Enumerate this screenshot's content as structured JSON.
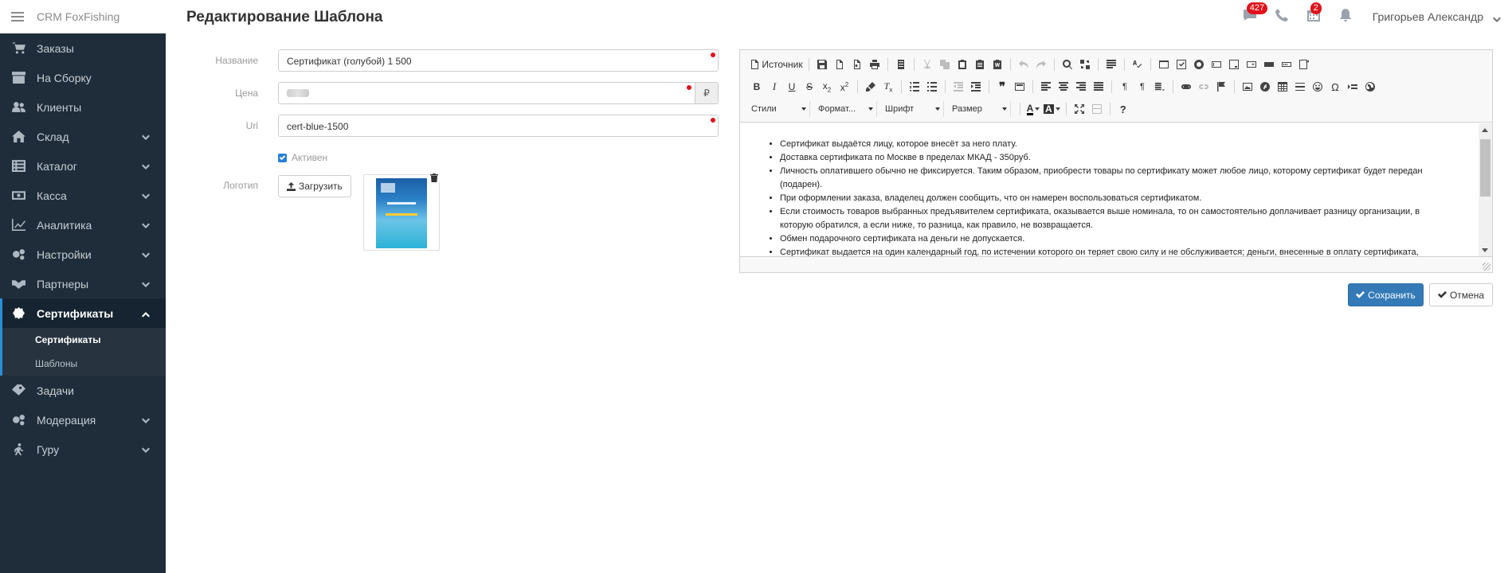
{
  "app": {
    "brand": "CRM FoxFishing",
    "page_title": "Редактирование Шаблона",
    "user": "Григорьев Александр"
  },
  "top_icons": {
    "messages_badge": "427",
    "calendar_badge": "2"
  },
  "sidebar": {
    "items": [
      {
        "label": "Заказы",
        "icon": "cart-icon"
      },
      {
        "label": "На Сборку",
        "icon": "box-icon"
      },
      {
        "label": "Клиенты",
        "icon": "users-icon"
      },
      {
        "label": "Склад",
        "icon": "home-icon"
      },
      {
        "label": "Каталог",
        "icon": "list-icon"
      },
      {
        "label": "Касса",
        "icon": "cash-icon"
      },
      {
        "label": "Аналитика",
        "icon": "chart-icon"
      },
      {
        "label": "Настройки",
        "icon": "gears-icon"
      },
      {
        "label": "Партнеры",
        "icon": "handshake-icon"
      },
      {
        "label": "Сертификаты",
        "icon": "certificate-icon"
      },
      {
        "label": "Задачи",
        "icon": "tag-icon"
      },
      {
        "label": "Модерация",
        "icon": "gears-icon"
      },
      {
        "label": "Гуру",
        "icon": "walk-icon"
      }
    ],
    "sub_items": [
      {
        "label": "Сертификаты"
      },
      {
        "label": "Шаблоны"
      }
    ]
  },
  "form": {
    "name_label": "Название",
    "name_value": "Сертификат (голубой) 1 500",
    "price_label": "Цена",
    "currency": "₽",
    "url_label": "Url",
    "url_value": "cert-blue-1500",
    "active_label": "Активен",
    "active_checked": true,
    "logo_label": "Логотип",
    "upload_label": "Загрузить"
  },
  "editor": {
    "source_label": "Источник",
    "combo_styles": "Стили",
    "combo_format": "Формат...",
    "combo_font": "Шрифт",
    "combo_size": "Размер",
    "content": [
      "Сертификат выдаётся лицу, которое внесёт за него плату.",
      "Доставка сертификата по Москве в пределах МКАД - 350руб.",
      "Личность оплатившего обычно не фиксируется. Таким образом, приобрести товары по сертификату может любое лицо, которому сертификат будет передан (подарен).",
      "При оформлении заказа, владелец должен сообщить, что он намерен воспользоваться сертификатом.",
      "Если стоимость товаров выбранных предъявителем сертификата, оказывается выше номинала, то он самостоятельно доплачивает разницу организации, в которую обратился, а если ниже, то разница, как правило, не возвращается.",
      "Обмен подарочного сертификата на деньги не допускается.",
      "Сертификат выдается на один календарный год, по истечении которого он теряет свою силу и не обслуживается; деньги, внесенные в оплату сертификата, после"
    ]
  },
  "actions": {
    "save": "Сохранить",
    "cancel": "Отмена"
  },
  "colors": {
    "sidebar_bg": "#1f2d3a",
    "accent": "#337ab7",
    "badge": "#e0111b"
  }
}
